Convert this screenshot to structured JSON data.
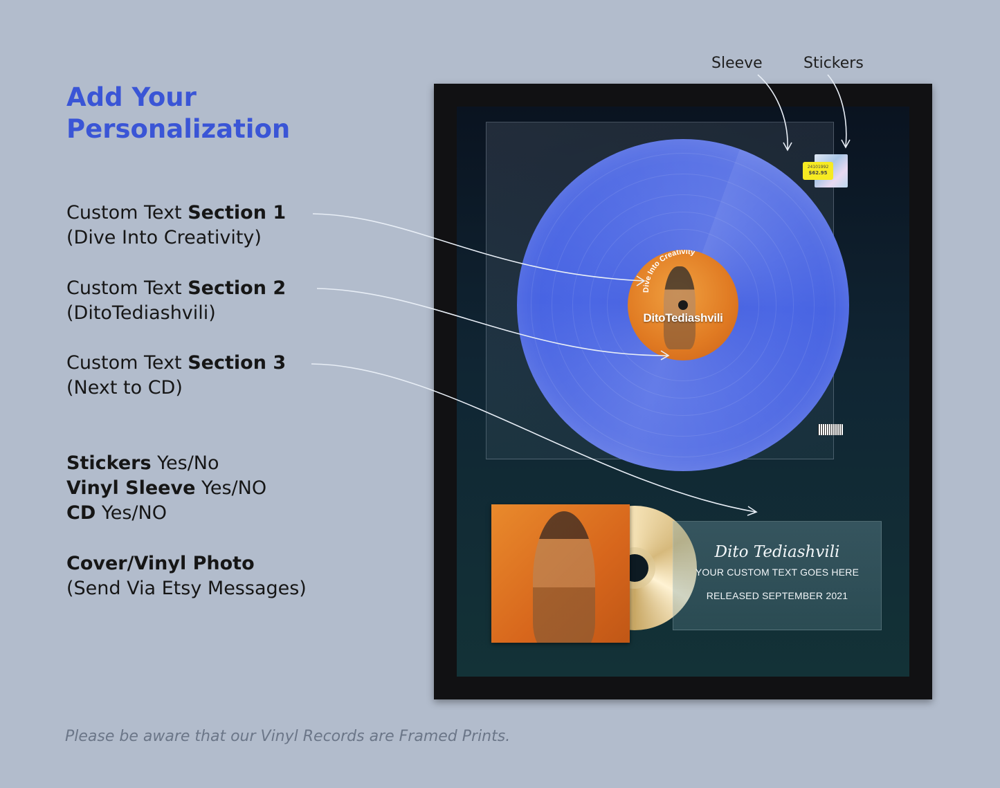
{
  "heading": {
    "line1": "Add Your",
    "line2": "Personalization"
  },
  "sections": [
    {
      "prefix": "Custom Text ",
      "bold": "Section 1",
      "detail": "(Dive Into Creativity)"
    },
    {
      "prefix": "Custom Text ",
      "bold": "Section 2",
      "detail": "(DitoTediashvili)"
    },
    {
      "prefix": "Custom Text ",
      "bold": "Section 3",
      "detail": "(Next to CD)"
    }
  ],
  "options": [
    {
      "bold": "Stickers",
      "value": " Yes/No"
    },
    {
      "bold": "Vinyl Sleeve",
      "value": " Yes/NO"
    },
    {
      "bold": "CD",
      "value": " Yes/NO"
    }
  ],
  "photo": {
    "bold": "Cover/Vinyl Photo",
    "detail": "(Send Via Etsy Messages)"
  },
  "annotations": {
    "sleeve": "Sleeve",
    "stickers": "Stickers"
  },
  "record": {
    "label_top": "Dive Into Creativity",
    "label_artist": "DitoTediashvili",
    "price_code": "24101992",
    "price": "$62.95"
  },
  "plaque": {
    "signature": "Dito Tediashvili",
    "line1": "YOUR CUSTOM TEXT GOES HERE",
    "line2": "RELEASED SEPTEMBER 2021"
  },
  "footnote": "Please be aware that our Vinyl Records are Framed Prints.",
  "colors": {
    "background": "#b2bccc",
    "accent": "#3a55d6",
    "vinyl": "#4a64e0",
    "label": "#e07a22"
  }
}
